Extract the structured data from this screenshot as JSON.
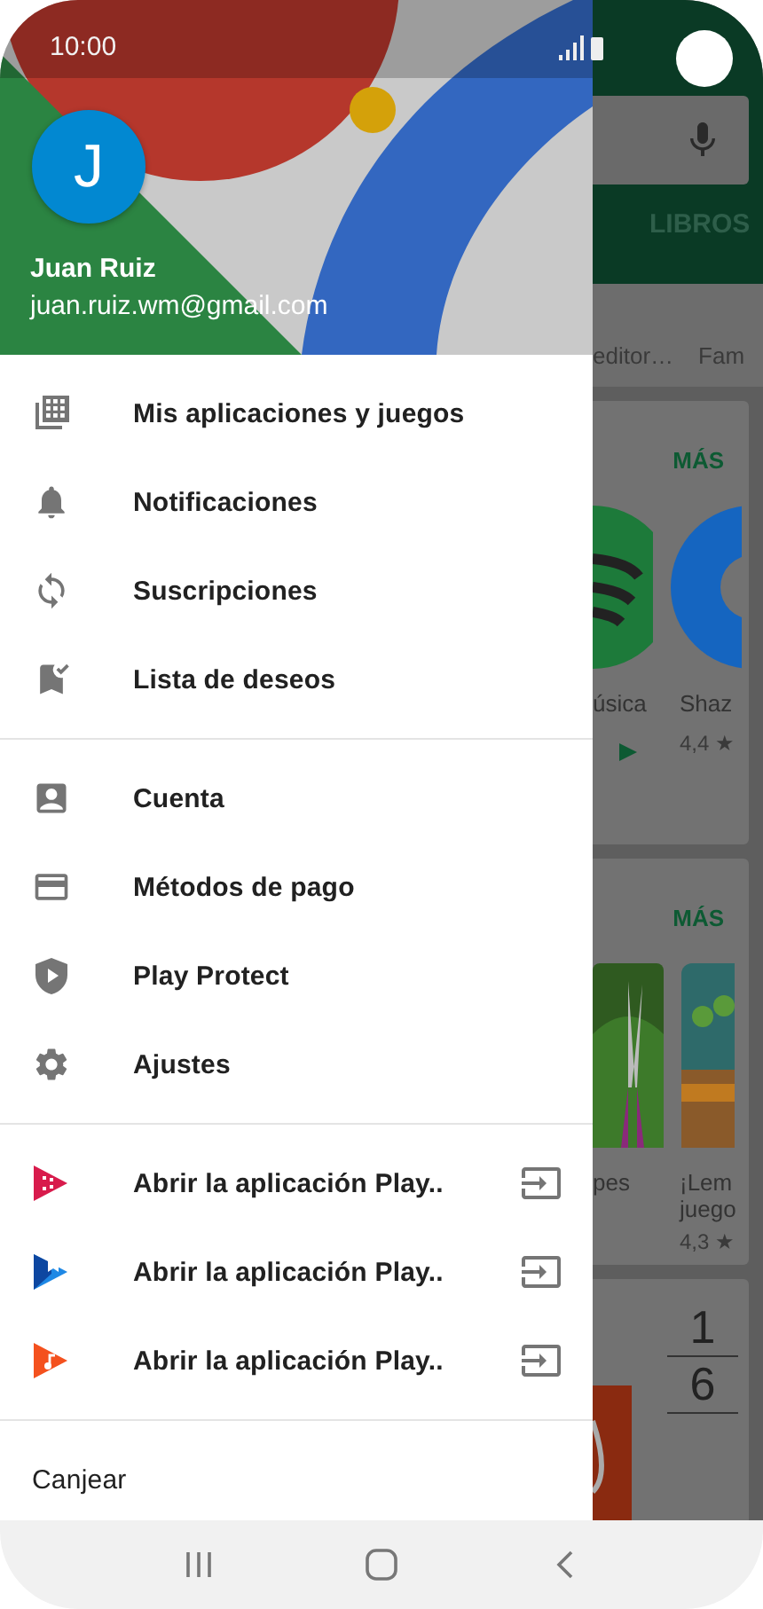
{
  "status_bar": {
    "time": "10:00"
  },
  "account": {
    "initial": "J",
    "name": "Juan Ruiz",
    "email": "juan.ruiz.wm@gmail.com"
  },
  "menu_sections": [
    {
      "items": [
        {
          "kind": "apps",
          "label": "Mis aplicaciones y juegos"
        },
        {
          "kind": "bell",
          "label": "Notificaciones"
        },
        {
          "kind": "sync",
          "label": "Suscripciones"
        },
        {
          "kind": "wishlist",
          "label": "Lista de deseos"
        }
      ]
    },
    {
      "items": [
        {
          "kind": "account",
          "label": "Cuenta"
        },
        {
          "kind": "card",
          "label": "Métodos de pago"
        },
        {
          "kind": "protect",
          "label": "Play Protect"
        },
        {
          "kind": "settings",
          "label": "Ajustes"
        }
      ]
    },
    {
      "items": [
        {
          "kind": "movies",
          "label": "Abrir la aplicación Play.."
        },
        {
          "kind": "books",
          "label": "Abrir la aplicación Play.."
        },
        {
          "kind": "music",
          "label": "Abrir la aplicación Play.."
        }
      ]
    },
    {
      "items": [
        {
          "kind": "text",
          "label": "Canjear"
        }
      ]
    }
  ],
  "background_app": {
    "tab": "LIBROS",
    "categories": [
      "editor…",
      "Fam"
    ],
    "cards": [
      {
        "more": "MÁS",
        "kind": "icons",
        "apps": [
          {
            "title": "úsica",
            "editor": true
          },
          {
            "title": "Shaz",
            "rating": "4,4 ★",
            "editor": false
          }
        ]
      },
      {
        "more": "MÁS",
        "kind": "games",
        "apps": [
          {
            "title": "pes"
          },
          {
            "title": "¡Lem\njuego",
            "rating": "4,3 ★"
          }
        ]
      },
      {
        "kind": "numbers",
        "numbers": [
          "1",
          "6"
        ]
      }
    ]
  }
}
